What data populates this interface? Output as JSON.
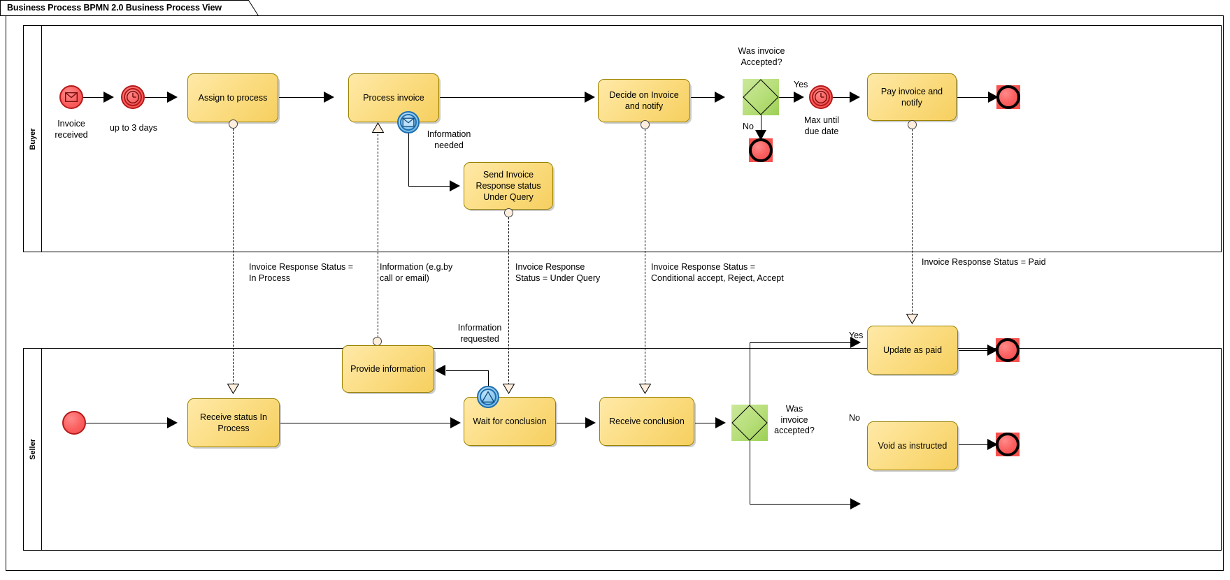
{
  "title": "Business Process BPMN 2.0 Business Process View",
  "lanes": [
    {
      "id": "buyer",
      "label": "Buyer"
    },
    {
      "id": "seller",
      "label": "Seller"
    }
  ],
  "colors": {
    "task_fill": "#fbdd83",
    "task_border": "#9a8200",
    "event_fill": "#fb5f5f",
    "event_border": "#b51a1a",
    "end_event_square": "#f8524f",
    "gateway_fill": "#b6de78",
    "boundary_fill": "#8ec9ef",
    "boundary_border": "#1f6fb0",
    "connector": "#000000"
  },
  "buyer": {
    "start_event": {
      "name": "message-start-event",
      "label": "Invoice\nreceived",
      "icon": "envelope-icon"
    },
    "timer_event": {
      "name": "timer-intermediate-event",
      "label": "up to 3 days",
      "icon": "clock-icon"
    },
    "tasks": [
      {
        "id": "assign",
        "label": "Assign to process"
      },
      {
        "id": "process_invoice",
        "label": "Process invoice"
      },
      {
        "id": "send_under_query",
        "label": "Send Invoice\nResponse status\nUnder Query"
      },
      {
        "id": "decide",
        "label": "Decide on Invoice\nand notify"
      },
      {
        "id": "pay",
        "label": "Pay invoice and\nnotify"
      }
    ],
    "boundary_event": {
      "name": "message-boundary-event",
      "label": "Information\nneeded",
      "icon": "envelope-icon"
    },
    "gateway": {
      "label": "Was invoice\nAccepted?",
      "yes": "Yes",
      "no": "No"
    },
    "timer_due": {
      "label": "Max until\ndue date",
      "icon": "clock-icon"
    },
    "end_events": [
      {
        "id": "rejected_end",
        "label": ""
      },
      {
        "id": "paid_end",
        "label": ""
      }
    ]
  },
  "seller": {
    "start_event": {
      "name": "start-event",
      "label": ""
    },
    "tasks": [
      {
        "id": "receive_status",
        "label": "Receive status In\nProcess"
      },
      {
        "id": "provide_info",
        "label": "Provide information"
      },
      {
        "id": "wait_conclusion",
        "label": "Wait for conclusion"
      },
      {
        "id": "receive_conclusion",
        "label": "Receive conclusion"
      },
      {
        "id": "update_paid",
        "label": "Update as paid"
      },
      {
        "id": "void",
        "label": "Void as instructed"
      }
    ],
    "boundary_event": {
      "name": "signal-boundary-event",
      "label": "Information\nrequested",
      "icon": "signal-icon"
    },
    "gateway": {
      "label": "Was\ninvoice\naccepted?",
      "yes": "Yes",
      "no": "No"
    },
    "end_events": [
      {
        "id": "paid_end",
        "label": ""
      },
      {
        "id": "void_end",
        "label": ""
      }
    ]
  },
  "message_flows": [
    {
      "id": "mf1",
      "label": "Invoice Response Status =\nIn Process"
    },
    {
      "id": "mf2",
      "label": "Information (e.g.by\n call or email)"
    },
    {
      "id": "mf3",
      "label": "Invoice Response\nStatus = Under Query"
    },
    {
      "id": "mf4",
      "label": "  Invoice Response Status =\nConditional accept, Reject, Accept"
    },
    {
      "id": "mf5",
      "label": "Invoice Response Status = Paid"
    }
  ]
}
